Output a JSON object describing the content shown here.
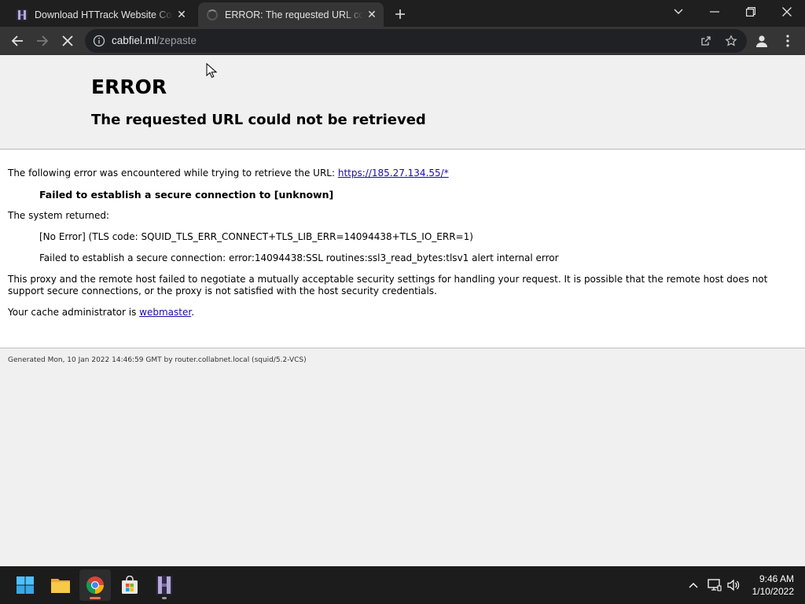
{
  "browser": {
    "tabs": [
      {
        "title": "Download HTTrack Website Copier",
        "state": "inactive",
        "icon": "httrack-favicon-icon"
      },
      {
        "title": "ERROR: The requested URL could not be retrieved",
        "state": "active-loading",
        "icon": "loading-spinner-icon"
      }
    ],
    "address": {
      "host": "cabfiel.ml",
      "path": "/zepaste"
    }
  },
  "page": {
    "heading": "ERROR",
    "subheading": "The requested URL could not be retrieved",
    "intro_text": "The following error was encountered while trying to retrieve the URL: ",
    "intro_link": "https://185.27.134.55/*",
    "error_bold": "Failed to establish a secure connection to [unknown]",
    "system_returned": "The system returned:",
    "tls_code": "[No Error] (TLS code: SQUID_TLS_ERR_CONNECT+TLS_LIB_ERR=14094438+TLS_IO_ERR=1)",
    "ssl_detail": "Failed to establish a secure connection: error:14094438:SSL routines:ssl3_read_bytes:tlsv1 alert internal error",
    "explanation": "This proxy and the remote host failed to negotiate a mutually acceptable security settings for handling your request. It is possible that the remote host does not support secure connections, or the proxy is not satisfied with the host security credentials.",
    "admin_text": "Your cache administrator is ",
    "admin_link": "webmaster",
    "admin_suffix": ".",
    "footer": "Generated Mon, 10 Jan 2022 14:46:59 GMT by router.collabnet.local (squid/5.2-VCS)"
  },
  "taskbar": {
    "apps": [
      "windows-start-icon",
      "file-explorer-icon",
      "chrome-icon",
      "microsoft-store-icon",
      "httrack-icon"
    ],
    "time": "9:46 AM",
    "date": "1/10/2022"
  },
  "colors": {
    "link": "#1a0dab",
    "tab_bg": "#1f1f1f",
    "toolbar_bg": "#353535",
    "omnibox_bg": "#202124",
    "taskbar_bg": "#1c1c1c",
    "chrome_active_underline": "#e5735d"
  }
}
